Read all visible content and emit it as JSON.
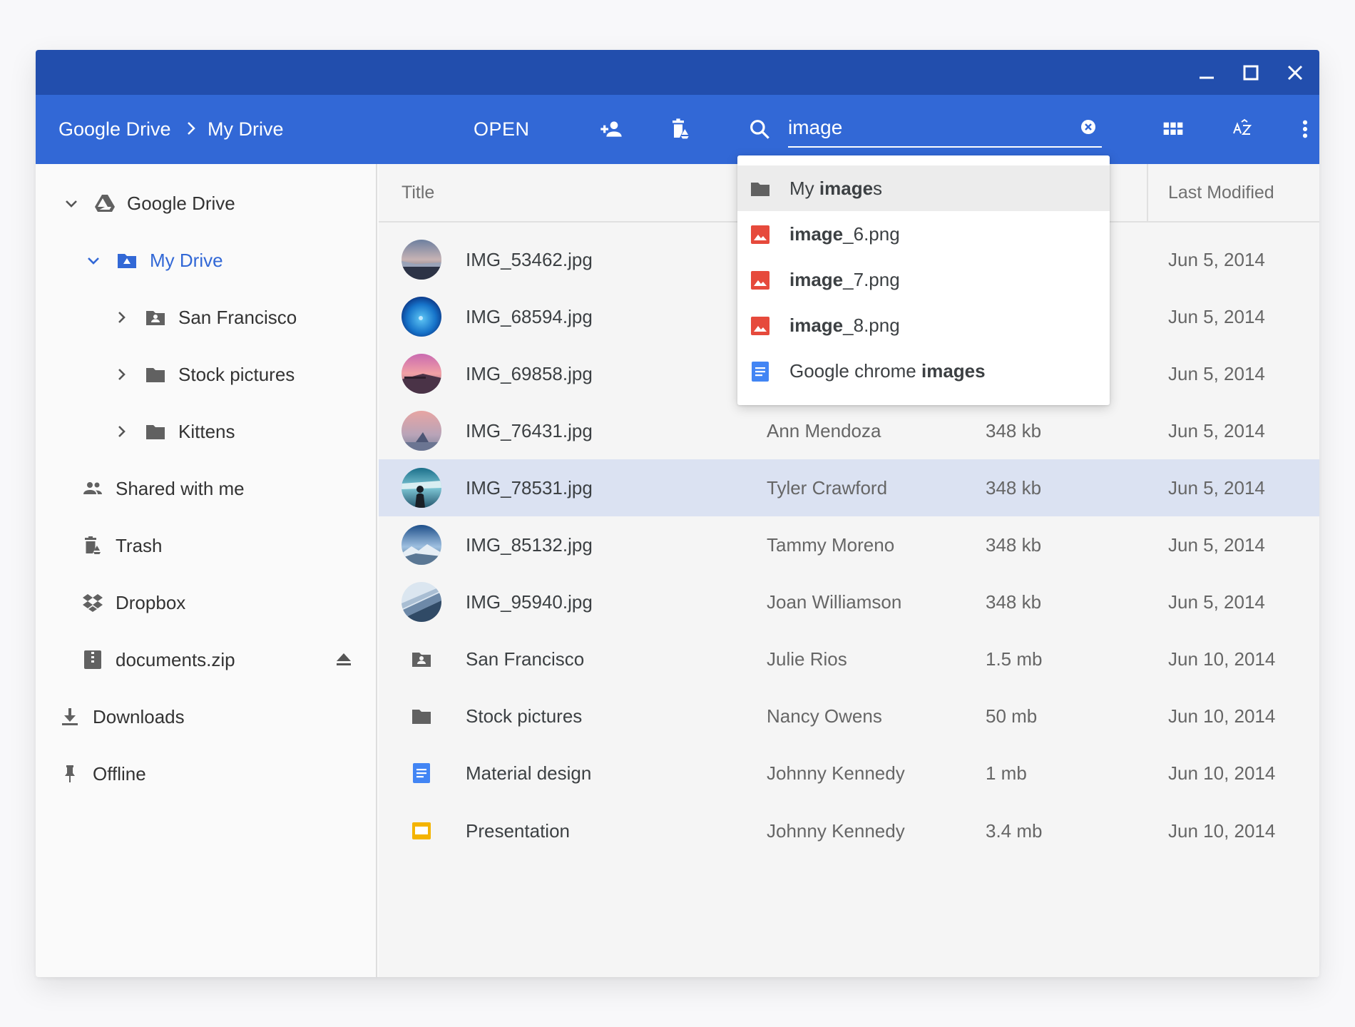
{
  "colors": {
    "titlebar": "#224ead",
    "toolbar": "#3268d6",
    "accent": "#3268d6",
    "selected_row": "#dbe2f2",
    "image_icon": "#e64a3c",
    "doc_icon": "#4285f4",
    "slides_icon": "#f4b400"
  },
  "window": {
    "controls": [
      "minimize-icon",
      "maximize-icon",
      "close-icon"
    ]
  },
  "toolbar": {
    "breadcrumb": [
      "Google Drive",
      "My Drive"
    ],
    "open_label": "OPEN",
    "icons": [
      "add-person-icon",
      "delete-drive-icon",
      "search-icon",
      "grid-view-icon",
      "sort-az-icon",
      "more-vert-icon"
    ],
    "sort_label": "AZ"
  },
  "search": {
    "value": "image",
    "suggestions": [
      {
        "prefix": "My ",
        "bold": "image",
        "suffix": "s",
        "icon": "folder-icon"
      },
      {
        "prefix": "",
        "bold": "image",
        "suffix": "_6.png",
        "icon": "image-file-icon"
      },
      {
        "prefix": "",
        "bold": "image",
        "suffix": "_7.png",
        "icon": "image-file-icon"
      },
      {
        "prefix": "",
        "bold": "image",
        "suffix": "_8.png",
        "icon": "image-file-icon"
      },
      {
        "prefix": "Google chrome ",
        "bold": "images",
        "suffix": "",
        "icon": "doc-icon"
      }
    ]
  },
  "sidebar": {
    "items": [
      {
        "label": "Google Drive",
        "icon": "google-drive-icon",
        "expanded": true
      },
      {
        "label": "My Drive",
        "icon": "my-drive-icon",
        "expanded": true,
        "selected": true
      },
      {
        "label": "San Francisco",
        "icon": "shared-folder-icon"
      },
      {
        "label": "Stock pictures",
        "icon": "folder-icon"
      },
      {
        "label": "Kittens",
        "icon": "folder-icon"
      },
      {
        "label": "Shared with me",
        "icon": "people-icon"
      },
      {
        "label": "Trash",
        "icon": "trash-icon"
      },
      {
        "label": "Dropbox",
        "icon": "dropbox-icon"
      },
      {
        "label": "documents.zip",
        "icon": "zip-icon"
      },
      {
        "label": "Downloads",
        "icon": "download-icon"
      },
      {
        "label": "Offline",
        "icon": "pin-icon"
      }
    ]
  },
  "table": {
    "columns": [
      "Title",
      "Last Modified"
    ],
    "rows": [
      {
        "title": "IMG_53462.jpg",
        "owner": "",
        "size": "",
        "modified": "Jun 5, 2014",
        "thumb": "sunset-lake"
      },
      {
        "title": "IMG_68594.jpg",
        "owner": "",
        "size": "",
        "modified": "Jun 5, 2014",
        "thumb": "blue-ocean"
      },
      {
        "title": "IMG_69858.jpg",
        "owner": "",
        "size": "",
        "modified": "Jun 5, 2014",
        "thumb": "pink-pier"
      },
      {
        "title": "IMG_76431.jpg",
        "owner": "Ann Mendoza",
        "size": "348 kb",
        "modified": "Jun 5, 2014",
        "thumb": "pink-sky"
      },
      {
        "title": "IMG_78531.jpg",
        "owner": "Tyler Crawford",
        "size": "348 kb",
        "modified": "Jun 5, 2014",
        "thumb": "person-lake",
        "selected": true
      },
      {
        "title": "IMG_85132.jpg",
        "owner": "Tammy Moreno",
        "size": "348 kb",
        "modified": "Jun 5, 2014",
        "thumb": "mountains"
      },
      {
        "title": "IMG_95940.jpg",
        "owner": "Joan Williamson",
        "size": "348 kb",
        "modified": "Jun 5, 2014",
        "thumb": "glass-building"
      },
      {
        "title": "San Francisco",
        "owner": "Julie Rios",
        "size": "1.5 mb",
        "modified": "Jun 10, 2014",
        "icon": "shared-folder-icon"
      },
      {
        "title": "Stock pictures",
        "owner": "Nancy Owens",
        "size": "50 mb",
        "modified": "Jun 10, 2014",
        "icon": "folder-icon"
      },
      {
        "title": "Material design",
        "owner": "Johnny Kennedy",
        "size": "1 mb",
        "modified": "Jun 10, 2014",
        "icon": "doc-icon"
      },
      {
        "title": "Presentation",
        "owner": "Johnny Kennedy",
        "size": "3.4 mb",
        "modified": "Jun 10, 2014",
        "icon": "slides-icon"
      }
    ]
  }
}
